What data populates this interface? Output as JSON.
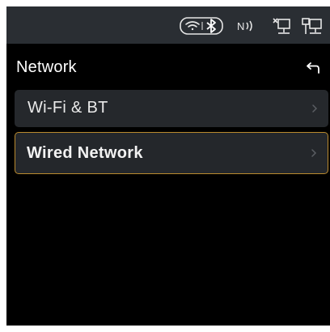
{
  "header": {
    "title": "Network",
    "back_icon": "back-arrow-icon"
  },
  "status_bar": {
    "icons": [
      "wifi-icon",
      "bluetooth-icon",
      "nfc-icon",
      "network-disconnected-icon",
      "network-connected-icon"
    ]
  },
  "menu": {
    "items": [
      {
        "label": "Wi-Fi & BT",
        "selected": false,
        "icon": "chevron-right-icon"
      },
      {
        "label": "Wired Network",
        "selected": true,
        "icon": "chevron-right-icon"
      }
    ]
  },
  "colors": {
    "background": "#000000",
    "status_bar": "#2a2e33",
    "item_background": "#25282c",
    "selected_border": "#b98a2e",
    "text": "#ffffff"
  }
}
